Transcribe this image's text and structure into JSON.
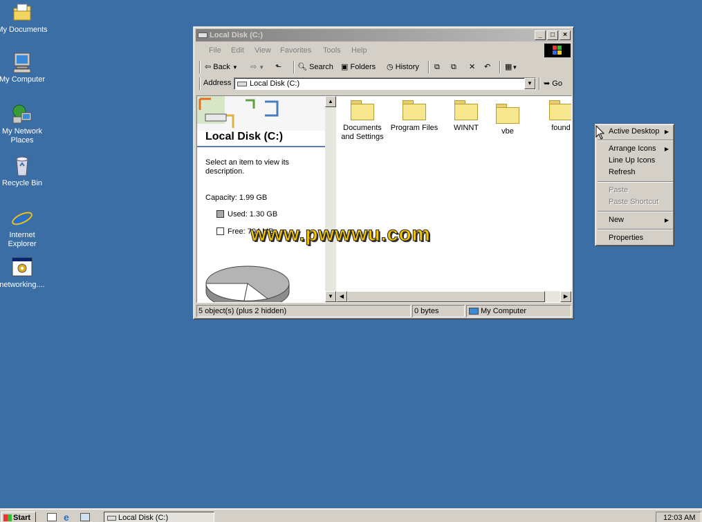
{
  "desktop": {
    "icons": [
      {
        "label": "My Documents",
        "icon": "folder-documents-icon"
      },
      {
        "label": "My Computer",
        "icon": "computer-icon"
      },
      {
        "label": "My Network",
        "label2": "Places",
        "icon": "network-places-icon"
      },
      {
        "label": "Recycle Bin",
        "icon": "recycle-bin-icon"
      },
      {
        "label": "Internet",
        "label2": "Explorer",
        "icon": "internet-explorer-icon"
      },
      {
        "label": "networking....",
        "icon": "setup-program-icon"
      }
    ],
    "background_color": "#3a6ea5"
  },
  "window": {
    "title": "Local Disk (C:)",
    "menu": [
      "File",
      "Edit",
      "View",
      "Favorites",
      "Tools",
      "Help"
    ],
    "toolbar": {
      "back": "Back",
      "search": "Search",
      "folders": "Folders",
      "history": "History"
    },
    "address": {
      "label": "Address",
      "value": "Local Disk (C:)",
      "go": "Go"
    },
    "left_pane": {
      "title": "Local Disk (C:)",
      "description": "Select an item to view its",
      "description2": "description.",
      "capacity": "Capacity: 1.99 GB",
      "used": "Used: 1.30 GB",
      "free": "Free: 704 MB"
    },
    "folders": [
      {
        "label": "Documents",
        "label2": "and Settings"
      },
      {
        "label": "Program Files",
        "label2": ""
      },
      {
        "label": "WINNT",
        "label2": ""
      },
      {
        "label": "vbe",
        "label2": ""
      },
      {
        "label": "found",
        "label2": ""
      }
    ],
    "status": {
      "objects": "5 object(s) (plus 2 hidden)",
      "size": "0 bytes",
      "zone": "My Computer"
    }
  },
  "context_menu": {
    "items": [
      {
        "label": "Active Desktop",
        "submenu": true,
        "disabled": false
      },
      {
        "label": "Arrange Icons",
        "submenu": true,
        "disabled": false
      },
      {
        "label": "Line Up Icons",
        "submenu": false,
        "disabled": false
      },
      {
        "label": "Refresh",
        "submenu": false,
        "disabled": false
      },
      {
        "label": "Paste",
        "submenu": false,
        "disabled": true
      },
      {
        "label": "Paste Shortcut",
        "submenu": false,
        "disabled": true
      },
      {
        "label": "New",
        "submenu": true,
        "disabled": false
      },
      {
        "label": "Properties",
        "submenu": false,
        "disabled": false
      }
    ]
  },
  "watermark": "www.pwwwu.com",
  "taskbar": {
    "start": "Start",
    "task": "Local Disk (C:)",
    "clock": "12:03 AM"
  }
}
